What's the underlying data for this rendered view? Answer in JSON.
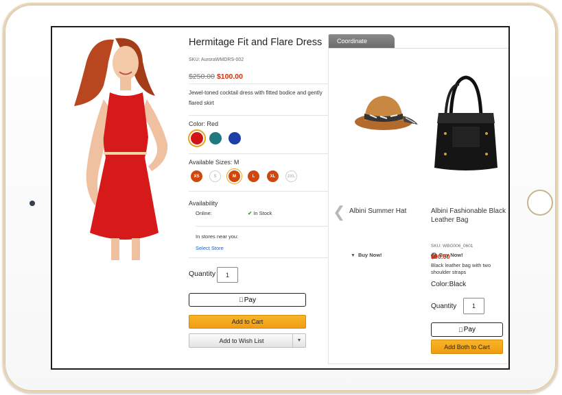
{
  "product": {
    "title": "Hermitage Fit and Flare Dress",
    "sku": "SKU: AuroraWMDRS-002",
    "old_price": "$250.00",
    "new_price": "$100.00",
    "description": "Jewel-toned cocktail dress with fitted bodice and gently flared skirt",
    "color_label": "Color: Red",
    "colors": [
      {
        "name": "Red",
        "hex": "#d41414",
        "selected": true
      },
      {
        "name": "Teal",
        "hex": "#1f7a7f",
        "selected": false
      },
      {
        "name": "Blue",
        "hex": "#1d3fa8",
        "selected": false
      }
    ],
    "sizes_label": "Available Sizes: M",
    "sizes": [
      {
        "label": "XS",
        "available": true,
        "selected": false
      },
      {
        "label": "S",
        "available": false,
        "selected": false
      },
      {
        "label": "M",
        "available": true,
        "selected": true
      },
      {
        "label": "L",
        "available": true,
        "selected": false
      },
      {
        "label": "XL",
        "available": true,
        "selected": false
      },
      {
        "label": "2XL",
        "available": false,
        "selected": false
      }
    ],
    "availability_label": "Availability",
    "online_label": "Online:",
    "online_status": "In Stock",
    "stores_label": "In stores near you:",
    "select_store": "Select Store",
    "quantity_label": "Quantity",
    "quantity_value": "1",
    "apple_pay": "Pay",
    "add_to_cart": "Add to Cart",
    "add_to_wishlist": "Add to Wish List"
  },
  "coordinate": {
    "tab_label": "Coordinate",
    "items": [
      {
        "name": "Albini Summer Hat",
        "buy_now": "Buy Now!"
      },
      {
        "name": "Albini Fashionable Black Leather Bag",
        "buy_now": "Buy Now!"
      }
    ],
    "detail": {
      "sku": "SKU: WBG006_0601",
      "price": "$90.00",
      "description": "Black leather bag with two shoulder straps",
      "color": "Color:Black",
      "quantity_label": "Quantity",
      "quantity_value": "1",
      "apple_pay": "Pay",
      "add_both": "Add Both to Cart"
    }
  },
  "colors": {
    "accent_orange": "#f19c10",
    "price_red": "#d12c0c",
    "link_blue": "#1c62c4",
    "size_orange": "#d2460b"
  }
}
